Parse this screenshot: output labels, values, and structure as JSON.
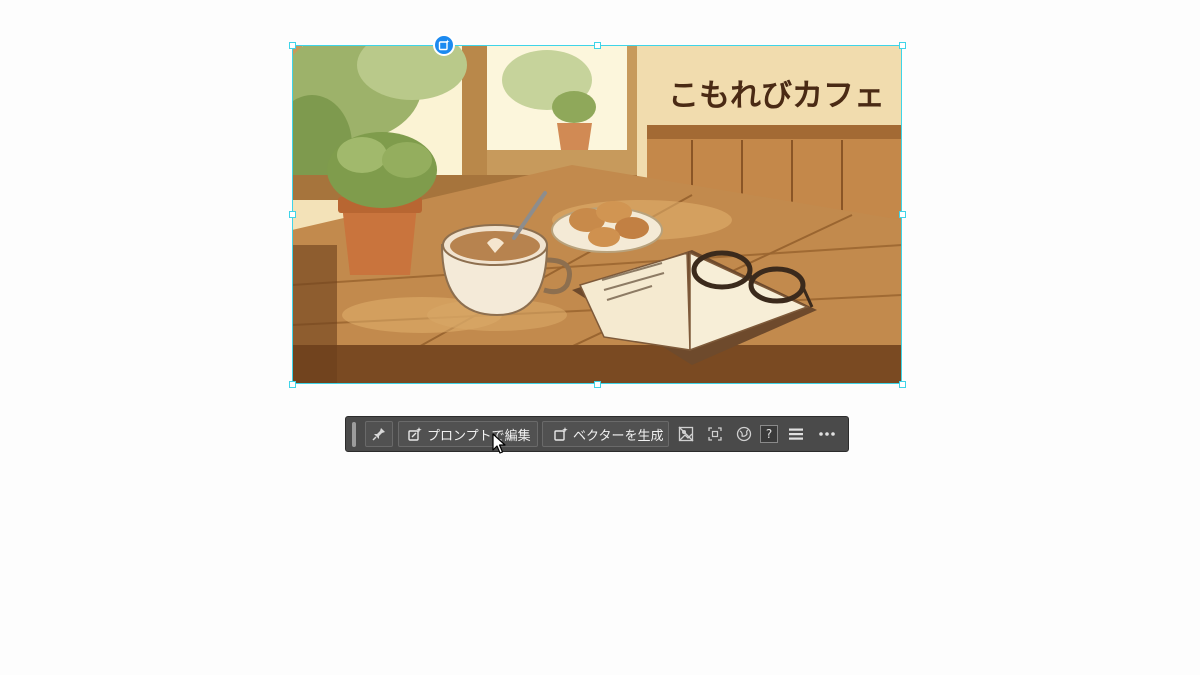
{
  "canvas": {
    "image_title": "こもれびカフェ"
  },
  "toolbar": {
    "pin_icon": "pin-icon",
    "edit_prompt_label": "プロンプトで編集",
    "generate_vector_label": "ベクターを生成",
    "tools": [
      "mask-icon",
      "crop-icon",
      "globe-icon",
      "help-icon",
      "menu-icon",
      "more-icon"
    ],
    "help_label": "?"
  },
  "colors": {
    "selection": "#3fd4e8",
    "badge": "#1c8af0",
    "toolbar_bg": "#4a4a4a"
  }
}
